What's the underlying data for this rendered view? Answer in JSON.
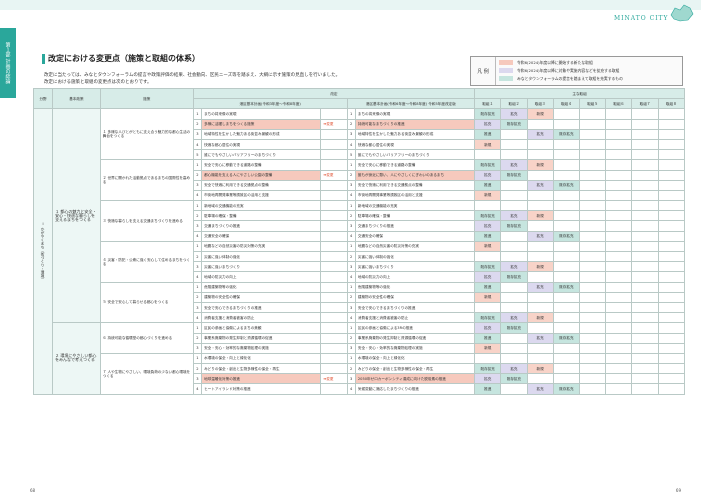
{
  "header": {
    "city": "MINATO CITY",
    "tab": "第１部 計画の総論"
  },
  "title": "改定における変更点（施策と取組の体系）",
  "intro": "改定に当たっては、みなとタウンフォーラムの提言や政策評価の結果、社会動向、区民ニーズ等を踏まえ、大綱に示す施策の見直しを行いました。改定における施策と取組の変更点は次のとおりです。",
  "legend": {
    "head": "凡 例",
    "rows": [
      {
        "sw": "#f6c9bd",
        "label": "新",
        "text": "令和6(2024)年度以降に開始する新たな取組"
      },
      {
        "sw": "#dcd9ef",
        "label": "変",
        "text": "令和6(2024)年度以降に対象や実施内容などを拡充する取組"
      },
      {
        "sw": "#c6e5df",
        "label": "継",
        "text": "みなとタウンフォーラムの提言を踏まえて取組を充実するもの"
      }
    ]
  },
  "table": {
    "h_bunya": "分野",
    "h_kihon": "基本政策",
    "h_shisaku": "施策",
    "h_kaitei": "改定",
    "h_before": "港区基本計画(令和3年度〜令和8年度)",
    "h_after": "港区基本計画(令和6年度〜令和8年度) 令和5年度改定版",
    "h_torikumi": "主な取組",
    "tk": [
      "取組１",
      "取組２",
      "取組３",
      "取組４",
      "取組５",
      "取組６",
      "取組７",
      "取組８"
    ],
    "goal1": "１ 都心の魅力と安全・安心・快適な暮らしを支えるまちをつくる",
    "goal2": "２ 環境にやさしい都心をみんなで考えつくる",
    "bunya": "Ⅰ かがやくまち（街づくり・環境）",
    "policies": [
      {
        "p": "１ 多様な人びとがともに支え合う魅力的な都心生活の舞台をつくる",
        "rows": [
          [
            "まちの将来像の実現",
            "まちの将来像の実現"
          ],
          [
            "多様に活躍しまちをつくる施策",
            "持続可能なまちづくりの推進"
          ],
          [
            "地域特性を生かした魅力ある街並み景観の形成",
            "地域特性を生かした魅力ある街並み景観の形成"
          ],
          [
            "快適な都心居住の実現",
            "快適な都心居住の実現"
          ],
          [
            "誰にでもやさしいバリアフリーのまちづくり",
            "誰にでもやさしいバリアフリーのまちづくり"
          ]
        ]
      },
      {
        "p": "２ 世界に開かれた活動拠点であるまちの国際性を高める",
        "rows": [
          [
            "安全で安心に移動できる道路の整備",
            "安全で安心に移動できる道路の整備"
          ],
          [
            "都心機能を支える人にやさしい公園の整備",
            "誰もが身近に憩い、人にやさしくにぎわいのあるまち"
          ],
          [
            "安全で快適に利用できる交通拠点の整備",
            "安全で快適に利用できる交通拠点の整備"
          ],
          [
            "市街地再開発事業等誘致区の活用と支援",
            "市街地再開発事業等誘致区の活用と支援"
          ]
        ]
      },
      {
        "p": "３ 快適な暮らしを支える交通まちづくりを進める",
        "rows": [
          [
            "新地域の交通機能の充実",
            "新地域の交通機能の充実"
          ],
          [
            "駐車場の確保・整備",
            "駐車場の確保・整備"
          ],
          [
            "交通まちづくりの推進",
            "交通まちづくりの推進"
          ],
          [
            "交通安全の確保",
            "交通安全の確保"
          ]
        ]
      },
      {
        "p": "４ 災害・防犯・公衆に強く安心して住めるまちをつくる",
        "rows": [
          [
            "地震などの自然災害の防災対策の充実",
            "地震などの自然災害の防災対策の充実"
          ],
          [
            "災害に強い体制の強化",
            "災害に強い体制の強化"
          ],
          [
            "災害に強いまちづくり",
            "災害に強いまちづくり"
          ],
          [
            "地域の防災力の向上",
            "地域の防災力の向上"
          ]
        ]
      },
      {
        "p": "５ 安全で安心して暮らせる都心をつくる",
        "rows": [
          [
            "危険建築物等の強化",
            "危険建築物等の強化"
          ],
          [
            "建築物の安全性の確保",
            "建築物の安全性の確保"
          ],
          [
            "安全で安心できるまちづくりの推進",
            "安全で安心できるまちづくりの推進"
          ],
          [
            "消費者支援と消費者被害の防止",
            "消費者支援と消費者被害の防止"
          ]
        ]
      },
      {
        "p": "６ 持続可能な循環型の都心づくりを進める",
        "rows": [
          [
            "区民の参画と協働によるまちの美観",
            "区民の参画と協働による3Rの推進"
          ],
          [
            "事業系廃棄物の発生抑制と資源循環の促進",
            "事業系廃棄物の発生抑制と資源循環の促進"
          ],
          [
            "安全・安心・効率的な廃棄物処理の実施",
            "安全・安心・効率的な廃棄物処理の実施"
          ]
        ]
      },
      {
        "p": "７ 人や生物にやさしい、環境負荷の少ない都心環境をつくる",
        "rows": [
          [
            "水環境の保全・向上と緑化化",
            "水環境の保全・向上と緑化化"
          ],
          [
            "みどりの保全・創出と生物多様性の保全・再生",
            "みどりの保全・創出と生物多様性の保全・再生"
          ],
          [
            "地球温暖化対策の推進",
            "2050年ゼロカーボンシティ達成に向けた脱炭素の推進"
          ],
          [
            "ヒートアイランド対策の推進",
            "気候変動に適応したまちづくりの推進"
          ]
        ]
      }
    ],
    "marks": [
      "既存拡充",
      "拡充",
      "新規",
      "推進",
      "継続"
    ],
    "change_label": "➡変更"
  },
  "pages": {
    "left": "68",
    "right": "69"
  }
}
